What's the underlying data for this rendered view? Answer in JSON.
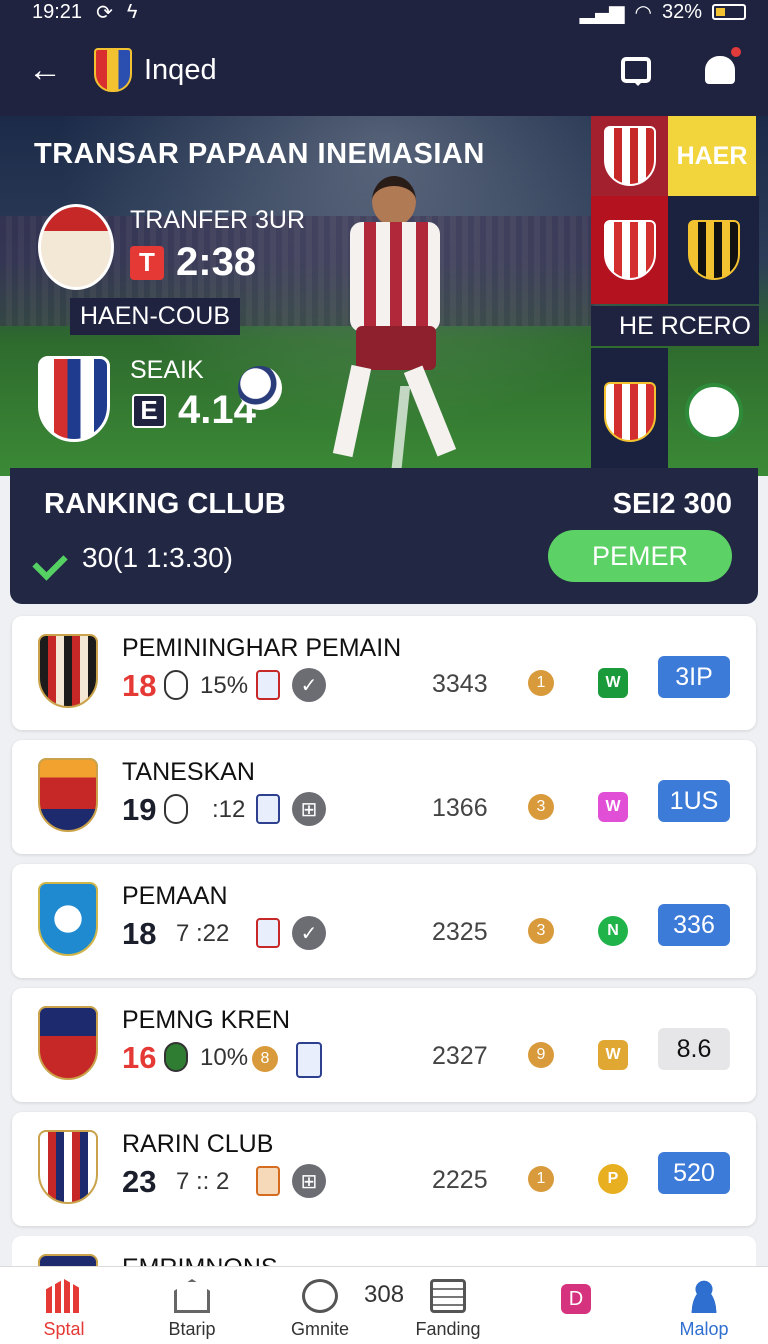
{
  "status": {
    "time": "19:21",
    "battery": "32%"
  },
  "appbar": {
    "title": "Inqed"
  },
  "hero": {
    "title": "TRANSAR PAPAAN INEMASIAN",
    "team_a_label": "TRANFER 3UR",
    "team_a_time": "2:38",
    "team_a_badge": "T",
    "middle_tag": "HAEN-COUB",
    "team_b_label": "SEAIK",
    "team_b_time": "4.14",
    "team_b_badge": "E",
    "side_label_top": "HAER",
    "side_label_mid": "HE RCERO"
  },
  "ranking": {
    "title": "RANKING CLLUB",
    "score": "SEI2 300",
    "sub": "30(1 1:3.30)",
    "button": "PEMER"
  },
  "clubs": [
    {
      "name": "PEMININGHAR PEMAIN",
      "rank": "18",
      "rank_color": "#e53935",
      "pct": "15%",
      "points": "3343",
      "coin": "1",
      "tag_color": "#1a9a3a",
      "tag": "W",
      "pill": "3IP",
      "pill_style": "blue"
    },
    {
      "name": "TANESKAN",
      "rank": "19",
      "rank_color": "#111111",
      "pct": ":12",
      "points": "1366",
      "coin": "3",
      "tag_color": "#e04fd6",
      "tag": "W",
      "pill": "1US",
      "pill_style": "blue"
    },
    {
      "name": "PEMAAN",
      "rank": "18",
      "rank_color": "#111111",
      "pct": "7 :22",
      "points": "2325",
      "coin": "3",
      "tag_color": "#1fb34a",
      "tag": "N",
      "pill": "336",
      "pill_style": "blue"
    },
    {
      "name": "PEMNG KREN",
      "rank": "16",
      "rank_color": "#e53935",
      "pct": "10%",
      "points": "2327",
      "coin": "9",
      "tag_color": "#e0a832",
      "tag": "W",
      "pill": "8.6",
      "pill_style": "grey"
    },
    {
      "name": "RARIN CLUB",
      "rank": "23",
      "rank_color": "#111111",
      "pct": "7 :: 2",
      "points": "2225",
      "coin": "1",
      "tag_color": "#e8b020",
      "tag": "P",
      "pill": "520",
      "pill_style": "blue"
    }
  ],
  "partial_club": {
    "name": "EMRIMNONS"
  },
  "nav": {
    "items": [
      {
        "label": "Sptal",
        "icon": "stadium-icon",
        "active": true
      },
      {
        "label": "Btarip",
        "icon": "home-icon",
        "active": false
      },
      {
        "label": "Gmnite",
        "icon": "circle-icon",
        "active": false
      },
      {
        "label": "Fanding",
        "icon": "list-icon",
        "active": false,
        "count": "308"
      },
      {
        "label": "",
        "icon": "d-badge-icon",
        "active": false
      },
      {
        "label": "Malop",
        "icon": "user-icon",
        "active": true
      }
    ]
  },
  "colors": {
    "header": "#1f2340",
    "accent_green": "#5cd165",
    "pill_blue": "#3d7bd9",
    "active_red": "#e53935"
  }
}
